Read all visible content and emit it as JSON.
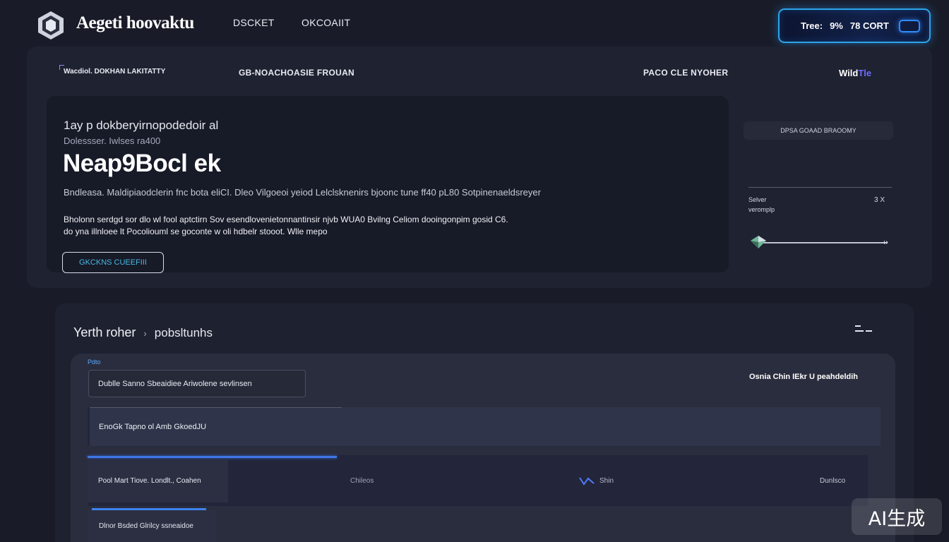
{
  "header": {
    "brand": "Aegeti hoovaktu",
    "nav": [
      "DSCKET",
      "OKCOAIIT"
    ],
    "status": {
      "label": "Tree:",
      "value_a": "9%",
      "value_b": "78 CORT"
    }
  },
  "subnav": {
    "items": [
      "Wacdiol. DOKHAN LAKITATTY",
      "GB-NOACHOASIE FROUAN",
      "PACO CLE NYOHER"
    ],
    "end_label": "Wild",
    "end_accent": "Tle"
  },
  "hero": {
    "eyebrow": "1ay p dokberyirnopodedoir al",
    "subtitle": "Dolessser. Iwlses ra400",
    "title": "Neap9Bocl ek",
    "line": "Bndleasa. Maldipiaodclerin fnc bota eliCI. Dleo Vilgoeoi yeiod Lelclsknenirs bjoonc tune ff40 pL80  Sotpinenaeldsreyer",
    "body": [
      "Bholonn serdgd sor dlo wl fool aptctirn Sov esendlovenietonnantinsir njvb WUA0 Bvilng Celiom dooingonpim gosid C6.",
      "do yna illnloee lt Pocoliouml se goconte w oli hdbelr stooot. Wlle mepo"
    ],
    "cta": "GKCKNS CUEEFIII"
  },
  "side": {
    "pill": "DPSA GOAAD BRAOOMY",
    "key1": "Selver",
    "key2": "veromplp",
    "value": "3 X"
  },
  "section": {
    "title": "Yerth roher",
    "crumb_sep": "›",
    "subtitle": "pobsltunhs"
  },
  "table": {
    "tag": "Pdto",
    "heading": "Osnia Chin IEkr U peahdeldih",
    "row_a": "Dublle Sanno Sbeaidiee  Ariwolene sevlinsen",
    "row_b": "EnoGk Tapno ol Amb GkoedJU",
    "row_c": {
      "col1": "Pool Mart Tiove. Londlt., Coahen",
      "col2": "Chileos",
      "col3": "Shin",
      "col4": "Dunlsco",
      "progress": 0.32
    },
    "row_d": {
      "col1": "Dlnor Bsded  Glrilcy ssneaidoe",
      "progress": 0.15
    }
  },
  "badge": "AI生成",
  "colors": {
    "accent": "#3d76e6",
    "status_border": "#2aa6e8",
    "link": "#49b9e6",
    "background": "#191c28"
  },
  "icons": [
    "logo-icon",
    "status-slot-icon",
    "filter-icon",
    "trend-icon",
    "slider-thumb-icon",
    "slider-end-icon"
  ]
}
